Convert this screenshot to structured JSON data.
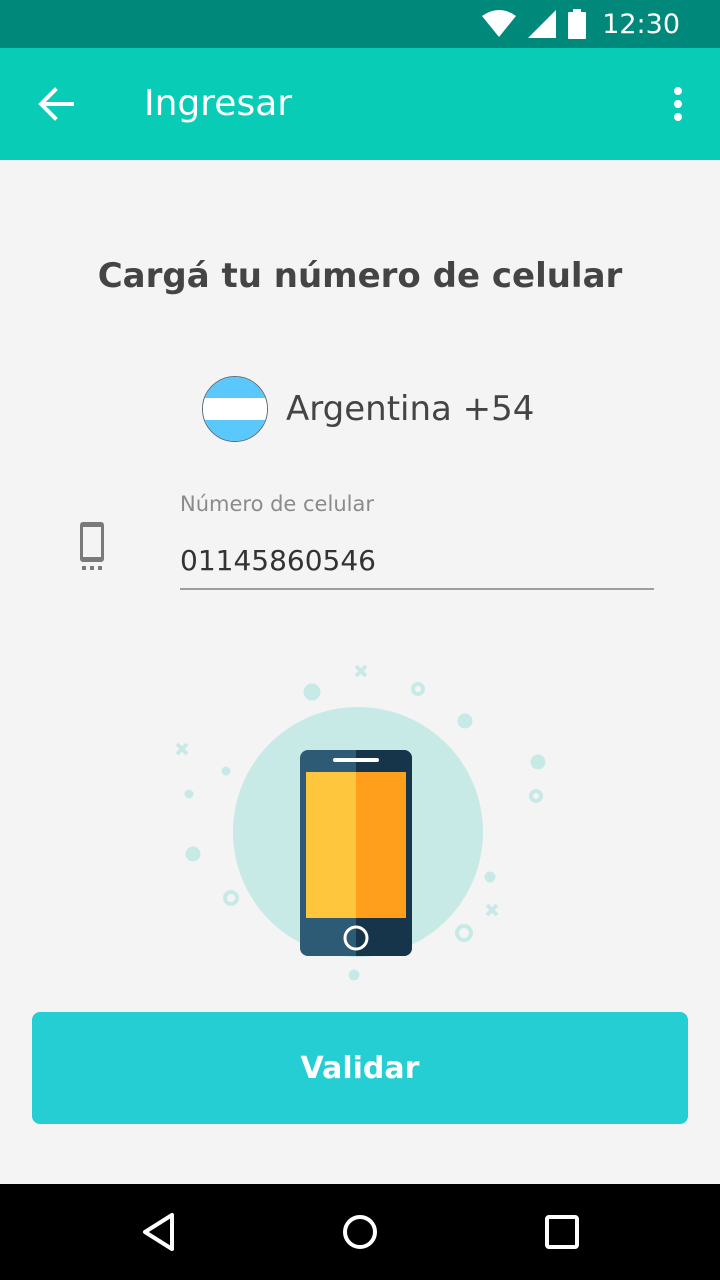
{
  "status_bar": {
    "time": "12:30",
    "icons": [
      "wifi-icon",
      "signal-icon",
      "battery-icon"
    ],
    "background": "#00897b"
  },
  "app_bar": {
    "title": "Ingresar",
    "background": "#08ccb5",
    "back_icon": "arrow-back-icon",
    "more_icon": "more-vert-icon"
  },
  "main": {
    "headline": "Cargá tu número de celular",
    "country": {
      "label": "Argentina +54",
      "flag_icon": "argentina-flag-icon"
    },
    "phone_field": {
      "label": "Número de celular",
      "value": "01145860546",
      "icon": "smartphone-icon"
    },
    "illustration": "phone-illustration",
    "validate_button": "Validar",
    "accent_color": "#24ced3"
  },
  "nav_bar": {
    "icons": [
      "back-triangle-icon",
      "home-circle-icon",
      "recents-square-icon"
    ]
  }
}
